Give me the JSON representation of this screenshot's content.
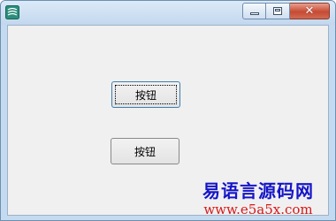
{
  "window": {
    "icon": "e-language-app-icon",
    "caption_buttons": {
      "minimize": "minimize-icon",
      "maximize": "maximize-icon",
      "close": "close-icon"
    }
  },
  "buttons": [
    {
      "label": "按钮",
      "focused": true
    },
    {
      "label": "按钮",
      "focused": false
    }
  ],
  "watermark": {
    "title": "易语言源码网",
    "url": "www.e5a5x.com",
    "title_color": "#1515c8",
    "url_color": "#d81818"
  }
}
